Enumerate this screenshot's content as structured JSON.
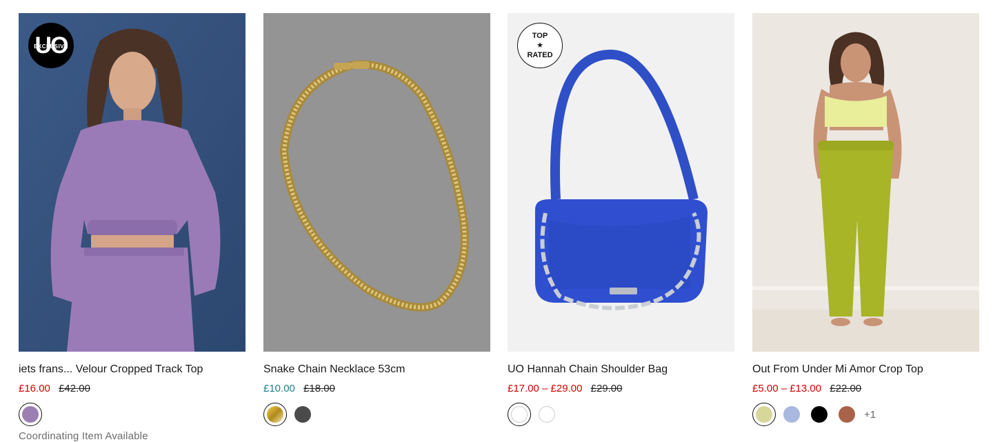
{
  "products": [
    {
      "name": "iets frans... Velour Cropped Track Top",
      "price_now": "£16.00",
      "price_was": "£42.00",
      "badge": {
        "line1": "UO",
        "line2": "EXCLUSIVE"
      },
      "swatches": [
        {
          "color": "#9b7fb3"
        }
      ],
      "note": "Coordinating Item Available"
    },
    {
      "name": "Snake Chain Necklace 53cm",
      "price_now": "£10.00",
      "price_was": "£18.00",
      "swatches": [
        {
          "color": "#e0b51c"
        },
        {
          "color": "#4a4a4a"
        }
      ]
    },
    {
      "name": "UO Hannah Chain Shoulder Bag",
      "price_now": "£17.00 – £29.00",
      "price_was": "£29.00",
      "badge": {
        "line1": "TOP",
        "line2": "RATED"
      },
      "swatches": [
        {
          "color": "#ffffff"
        },
        {
          "color": "#ffffff"
        }
      ]
    },
    {
      "name": "Out From Under Mi Amor Crop Top",
      "price_now": "£5.00 – £13.00",
      "price_was": "£22.00",
      "swatches": [
        {
          "color": "#d8d79a"
        },
        {
          "color": "#a9b8df"
        },
        {
          "color": "#000000"
        },
        {
          "color": "#a8634a"
        }
      ],
      "more_colors": "+1"
    }
  ]
}
